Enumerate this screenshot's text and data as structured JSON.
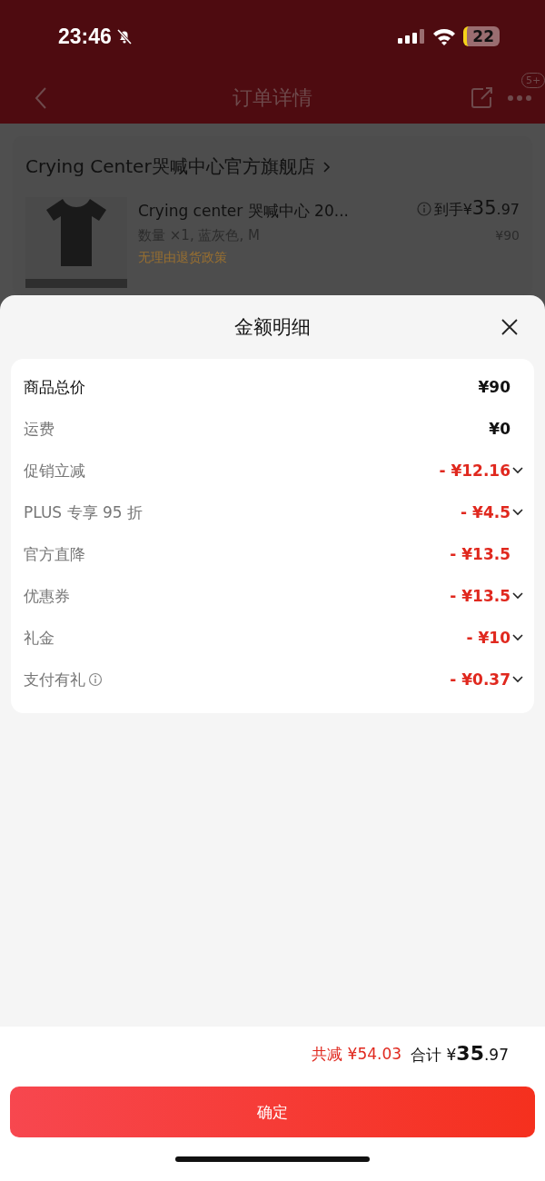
{
  "status_bar": {
    "time": "23:46",
    "muted": true,
    "battery": "22"
  },
  "nav": {
    "title": "订单详情",
    "badge": "5+"
  },
  "order": {
    "store": "Crying Center哭喊中心官方旗舰店",
    "product": {
      "title": "Crying center 哭喊中心 20...",
      "spec": "数量 ×1, 蓝灰色, M",
      "price_label": "到手",
      "currency": "¥",
      "price_int": "35",
      "price_dec": ".97",
      "original_price": "¥90",
      "policy": "无理由退货政策"
    }
  },
  "sheet": {
    "title": "金额明细",
    "rows": [
      {
        "label": "商品总价",
        "amount": "¥90",
        "kind": "total",
        "expandable": false,
        "info": false
      },
      {
        "label": "运费",
        "amount": "¥0",
        "kind": "normal",
        "expandable": false,
        "info": false
      },
      {
        "label": "促销立减",
        "amount": "- ¥12.16",
        "kind": "discount",
        "expandable": true,
        "info": false
      },
      {
        "label": "PLUS 专享 95 折",
        "amount": "- ¥4.5",
        "kind": "discount",
        "expandable": true,
        "info": false
      },
      {
        "label": "官方直降",
        "amount": "- ¥13.5",
        "kind": "discount",
        "expandable": false,
        "info": false
      },
      {
        "label": "优惠券",
        "amount": "- ¥13.5",
        "kind": "discount",
        "expandable": true,
        "info": false
      },
      {
        "label": "礼金",
        "amount": "- ¥10",
        "kind": "discount",
        "expandable": true,
        "info": false
      },
      {
        "label": "支付有礼",
        "amount": "- ¥0.37",
        "kind": "discount",
        "expandable": true,
        "info": true
      }
    ],
    "footer": {
      "saved": "共减 ¥54.03",
      "total_label": "合计",
      "currency": "¥",
      "total_int": "35",
      "total_dec": ".97"
    },
    "confirm": "确定"
  }
}
